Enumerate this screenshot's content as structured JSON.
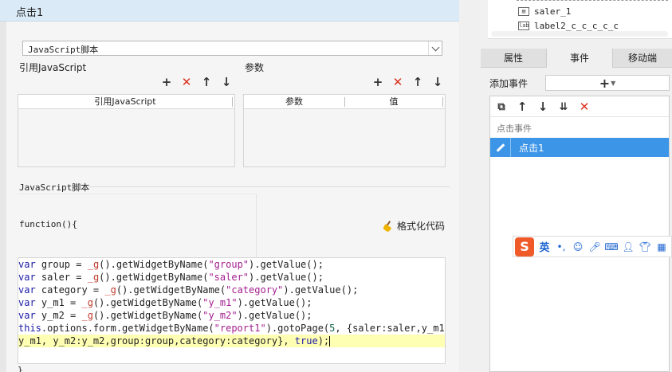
{
  "dialog": {
    "title": "点击1",
    "script_type_selected": "JavaScript脚本",
    "ref_section_label": "引用JavaScript",
    "params_section_label": "参数",
    "ref_grid_header": "引用JavaScript",
    "params_grid_headers": [
      "参数",
      "值"
    ],
    "script_section_label": "JavaScript脚本",
    "function_header": "function(){",
    "format_button_label": "格式化代码",
    "closing_brace": "}"
  },
  "right_panel": {
    "tree_items": [
      "saler_1",
      "label2_c_c_c_c_c"
    ],
    "tabs": [
      "属性",
      "事件",
      "移动端"
    ],
    "active_tab": "事件",
    "add_event_label": "添加事件",
    "event_group_label": "点击事件",
    "selected_event": "点击1"
  },
  "ime": {
    "logo": "S",
    "mode": "英"
  },
  "colors": {
    "title_bar": "#daeaf7",
    "selected_row": "#3d95e8",
    "delete_icon": "#d9301e",
    "highlight_line": "#ffffb3"
  }
}
